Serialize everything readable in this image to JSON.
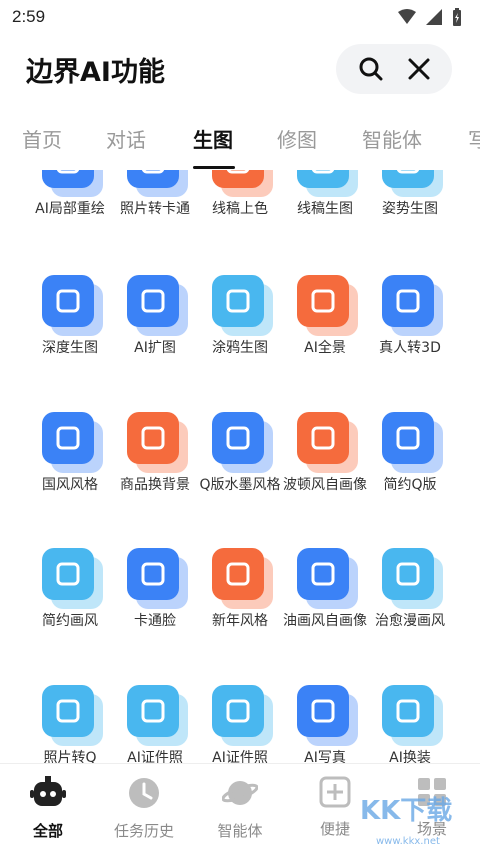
{
  "status": {
    "time": "2:59"
  },
  "header": {
    "title": "边界AI功能"
  },
  "tabs": [
    "首页",
    "对话",
    "生图",
    "修图",
    "智能体",
    "写"
  ],
  "active_tab_index": 2,
  "colors": {
    "blue": "#3b82f6",
    "lightblue": "#49b7ef",
    "orange": "#f56b3d",
    "red": "#ef4444"
  },
  "grid": {
    "rows": [
      [
        {
          "label": "AI局部重绘",
          "color": "#3b82f6",
          "icon": "inpaint-icon"
        },
        {
          "label": "照片转卡通",
          "color": "#3b82f6",
          "icon": "cartoon-photo-icon"
        },
        {
          "label": "线稿上色",
          "color": "#f56b3d",
          "icon": "lineart-color-icon"
        },
        {
          "label": "线稿生图",
          "color": "#49b7ef",
          "icon": "lineart-image-icon"
        },
        {
          "label": "姿势生图",
          "color": "#49b7ef",
          "icon": "pose-icon"
        }
      ],
      [
        {
          "label": "深度生图",
          "color": "#3b82f6",
          "icon": "layers-icon"
        },
        {
          "label": "AI扩图",
          "color": "#3b82f6",
          "icon": "expand-icon"
        },
        {
          "label": "涂鸦生图",
          "color": "#49b7ef",
          "icon": "doodle-icon"
        },
        {
          "label": "AI全景",
          "color": "#f56b3d",
          "icon": "panorama-360-icon"
        },
        {
          "label": "真人转3D",
          "color": "#3b82f6",
          "icon": "3d-icon"
        }
      ],
      [
        {
          "label": "国风风格",
          "color": "#3b82f6",
          "icon": "fan-icon"
        },
        {
          "label": "商品换背景",
          "color": "#f56b3d",
          "icon": "shopping-bag-icon"
        },
        {
          "label": "Q版水墨风格",
          "color": "#3b82f6",
          "icon": "ink-mountain-icon"
        },
        {
          "label": "波顿风自画像",
          "color": "#f56b3d",
          "icon": "sparkle-icon"
        },
        {
          "label": "简约Q版",
          "color": "#3b82f6",
          "icon": "smile-icon"
        }
      ],
      [
        {
          "label": "简约画风",
          "color": "#49b7ef",
          "icon": "frame-heart-icon"
        },
        {
          "label": "卡通脸",
          "color": "#3b82f6",
          "icon": "dog-face-icon"
        },
        {
          "label": "新年风格",
          "color": "#f56b3d",
          "icon": "newyear-icon"
        },
        {
          "label": "油画风自画像",
          "color": "#3b82f6",
          "icon": "paint-roller-icon"
        },
        {
          "label": "治愈漫画风",
          "color": "#49b7ef",
          "icon": "heart-plus-icon"
        }
      ],
      [
        {
          "label": "照片转Q",
          "color": "#49b7ef",
          "icon": "id-photo-icon"
        },
        {
          "label": "AI证件照",
          "color": "#49b7ef",
          "icon": "id-card-icon"
        },
        {
          "label": "AI证件照",
          "color": "#49b7ef",
          "icon": "id-card-person-icon"
        },
        {
          "label": "AI写真",
          "color": "#3b82f6",
          "icon": "portrait-headphone-icon"
        },
        {
          "label": "AI换装",
          "color": "#49b7ef",
          "icon": "suit-icon"
        }
      ]
    ]
  },
  "bottom_nav": [
    {
      "label": "全部",
      "icon": "robot-icon",
      "active": true
    },
    {
      "label": "任务历史",
      "icon": "clock-icon",
      "active": false
    },
    {
      "label": "智能体",
      "icon": "planet-icon",
      "active": false
    },
    {
      "label": "便捷",
      "icon": "plus-square-icon",
      "active": false
    },
    {
      "label": "场景",
      "icon": "grid-icon",
      "active": false
    }
  ],
  "watermark": {
    "text": "KK下载",
    "url": "www.kkx.net"
  }
}
